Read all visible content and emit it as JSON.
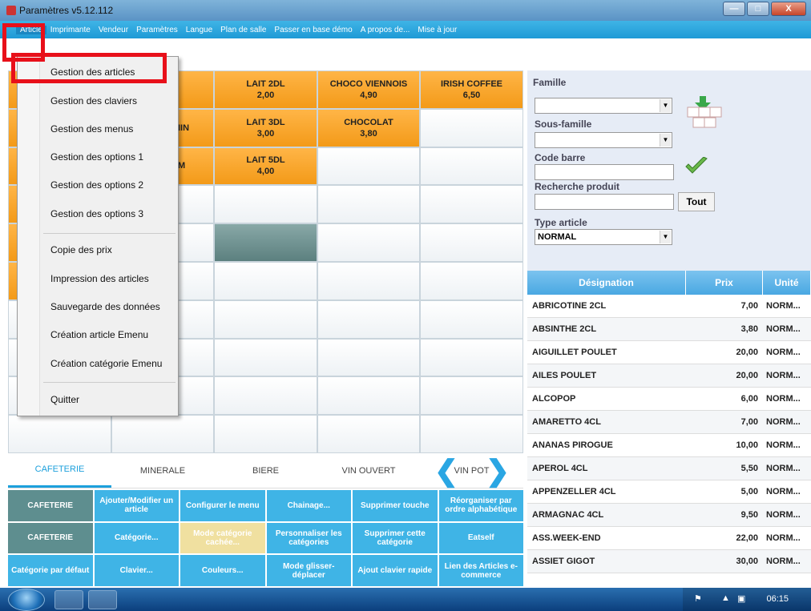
{
  "window": {
    "title": "Paramètres v5.12.112",
    "btn_min": "—",
    "btn_max": "□",
    "btn_close": "X"
  },
  "menubar": [
    "Article",
    "Imprimante",
    "Vendeur",
    "Paramètres",
    "Langue",
    "Plan de salle",
    "Passer en base démo",
    "A propos de...",
    "Mise à jour"
  ],
  "dropdown": {
    "items": [
      "Gestion des articles",
      "Gestion des claviers",
      "Gestion des menus",
      "Gestion des options 1",
      "Gestion des options 2",
      "Gestion des options 3",
      "Copie des prix",
      "Impression des articles",
      "Sauvegarde des données",
      "Création article Emenu",
      "Création catégorie Emenu",
      "Quitter"
    ]
  },
  "grid": {
    "lait2": {
      "name": "LAIT 2DL",
      "price": "2,00"
    },
    "choco_viennois": {
      "name": "CHOCO VIENNOIS",
      "price": "4,90"
    },
    "irish": {
      "name": "IRISH COFFEE",
      "price": "6,50"
    },
    "partial1": "IIN",
    "lait3": {
      "name": "LAIT 3DL",
      "price": "3,00"
    },
    "chocolat": {
      "name": "CHOCOLAT",
      "price": "3,80"
    },
    "partial2": "M",
    "lait5": {
      "name": "LAIT 5DL",
      "price": "4,00"
    }
  },
  "tabs": [
    "CAFETERIE",
    "MINERALE",
    "BIERE",
    "VIN OUVERT",
    "VIN POT"
  ],
  "nav": {
    "prev": "❮",
    "next": "❯"
  },
  "actions": [
    "CAFETERIE",
    "Ajouter/Modifier un article",
    "Configurer le menu",
    "Chainage...",
    "Supprimer touche",
    "Réorganiser par ordre alphabétique",
    "CAFETERIE",
    "Catégorie...",
    "Mode catégorie cachée...",
    "Personnaliser les catégories",
    "Supprimer cette catégorie",
    "Eatself",
    "Catégorie par défaut",
    "Clavier...",
    "Couleurs...",
    "Mode glisser-déplacer",
    "Ajout clavier rapide",
    "Lien des Articles e-commerce"
  ],
  "filters": {
    "famille_label": "Famille",
    "famille_value": "",
    "sousfamille_label": "Sous-famille",
    "sousfamille_value": "",
    "codebarre_label": "Code barre",
    "recherche_label": "Recherche produit",
    "tout_button": "Tout",
    "type_label": "Type article",
    "type_value": "NORMAL"
  },
  "table": {
    "headers": [
      "Désignation",
      "Prix",
      "Unité"
    ],
    "rows": [
      [
        "ABRICOTINE 2CL",
        "7,00",
        "NORM..."
      ],
      [
        "ABSINTHE 2CL",
        "3,80",
        "NORM..."
      ],
      [
        "AIGUILLET POULET",
        "20,00",
        "NORM..."
      ],
      [
        "AILES POULET",
        "20,00",
        "NORM..."
      ],
      [
        "ALCOPOP",
        "6,00",
        "NORM..."
      ],
      [
        "AMARETTO 4CL",
        "7,00",
        "NORM..."
      ],
      [
        "ANANAS PIROGUE",
        "10,00",
        "NORM..."
      ],
      [
        "APEROL 4CL",
        "5,50",
        "NORM..."
      ],
      [
        "APPENZELLER 4CL",
        "5,00",
        "NORM..."
      ],
      [
        "ARMAGNAC 4CL",
        "9,50",
        "NORM..."
      ],
      [
        "ASS.WEEK-END",
        "22,00",
        "NORM..."
      ],
      [
        "ASSIET GIGOT",
        "30,00",
        "NORM..."
      ]
    ]
  },
  "taskbar": {
    "clock": "06:15"
  }
}
